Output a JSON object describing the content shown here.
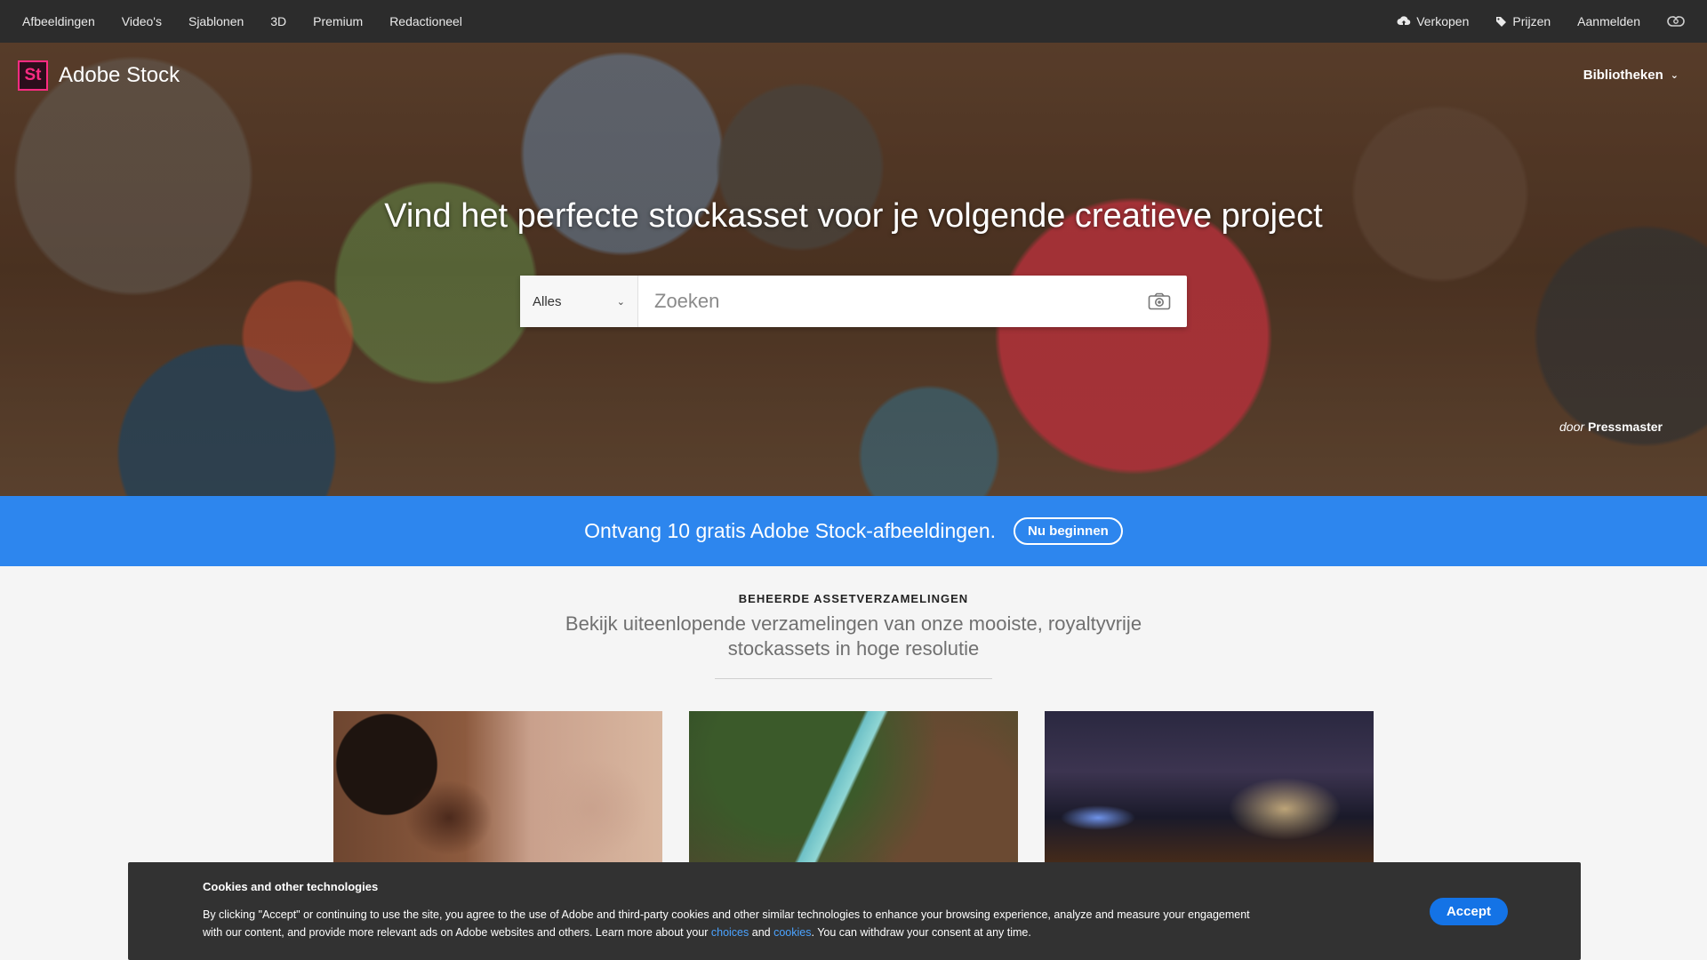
{
  "topnav": {
    "left_items": [
      "Afbeeldingen",
      "Video's",
      "Sjablonen",
      "3D",
      "Premium",
      "Redactioneel"
    ],
    "sell_label": "Verkopen",
    "pricing_label": "Prijzen",
    "signin_label": "Aanmelden"
  },
  "brand": {
    "logo_text": "St",
    "name": "Adobe Stock"
  },
  "hero": {
    "libraries_label": "Bibliotheken",
    "title": "Vind het perfecte stockasset voor je volgende creatieve project",
    "search": {
      "filter_value": "Alles",
      "placeholder": "Zoeken"
    },
    "credit_prefix": "door",
    "credit_author": "Pressmaster"
  },
  "promo": {
    "text": "Ontvang 10 gratis Adobe Stock-afbeeldingen.",
    "button_label": "Nu beginnen"
  },
  "collections": {
    "label": "BEHEERDE ASSETVERZAMELINGEN",
    "subtitle": "Bekijk uiteenlopende verzamelingen van onze mooiste, royaltyvrije stockassets in hoge resolutie"
  },
  "cookie": {
    "title": "Cookies and other technologies",
    "text_part1": "By clicking \"Accept\" or continuing to use the site, you agree to the use of Adobe and third-party cookies and other similar technologies to enhance your browsing experience, analyze and measure your engagement with our content, and provide more relevant ads on Adobe websites and others. Learn more about your ",
    "link_choices": "choices",
    "text_and": " and ",
    "link_cookies": "cookies",
    "text_part2": ". You can withdraw your consent at any time.",
    "accept_label": "Accept"
  },
  "colors": {
    "topnav_bg": "#2c2c2c",
    "promo_bg": "#2d86ee",
    "accent_pink": "#ff2b82",
    "accept_blue": "#1473e6",
    "link_blue": "#4ba3ff"
  },
  "icons": [
    "upload-cloud-icon",
    "tag-icon",
    "creative-cloud-icon",
    "chevron-down-icon",
    "camera-icon"
  ]
}
